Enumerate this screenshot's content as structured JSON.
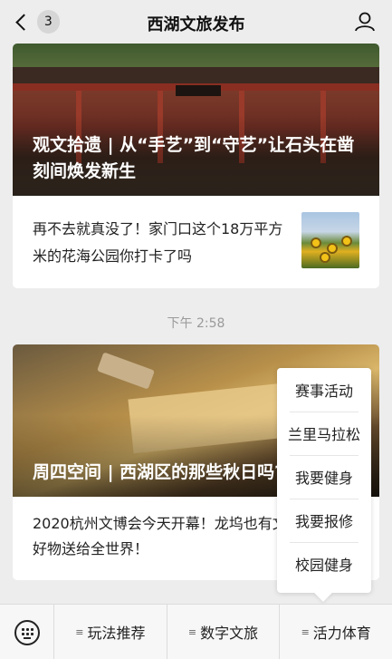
{
  "header": {
    "badge_count": "3",
    "title": "西湖文旅发布"
  },
  "articles": [
    {
      "hero_title": "观文拾遗 | 从“手艺”到“守艺”让石头在凿刻间焕发新生",
      "sub_title": "再不去就真没了！家门口这个18万平方米的花海公园你打卡了吗"
    },
    {
      "hero_title": "周四空间 | 西湖区的那些秋日吗?",
      "sub_title": "2020杭州文博会今天开幕！龙坞也有文创好物送给全世界！"
    }
  ],
  "timestamp": "下午 2:58",
  "popup_menu": {
    "items": [
      "赛事活动",
      "兰里马拉松",
      "我要健身",
      "我要报修",
      "校园健身"
    ]
  },
  "bottom_tabs": [
    "玩法推荐",
    "数字文旅",
    "活力体育"
  ],
  "colors": {
    "background": "#ededed",
    "card": "#ffffff",
    "time_text": "#9a9a9a"
  },
  "icons": [
    "back-icon",
    "profile-icon",
    "keyboard-icon",
    "menu-lines-icon"
  ]
}
